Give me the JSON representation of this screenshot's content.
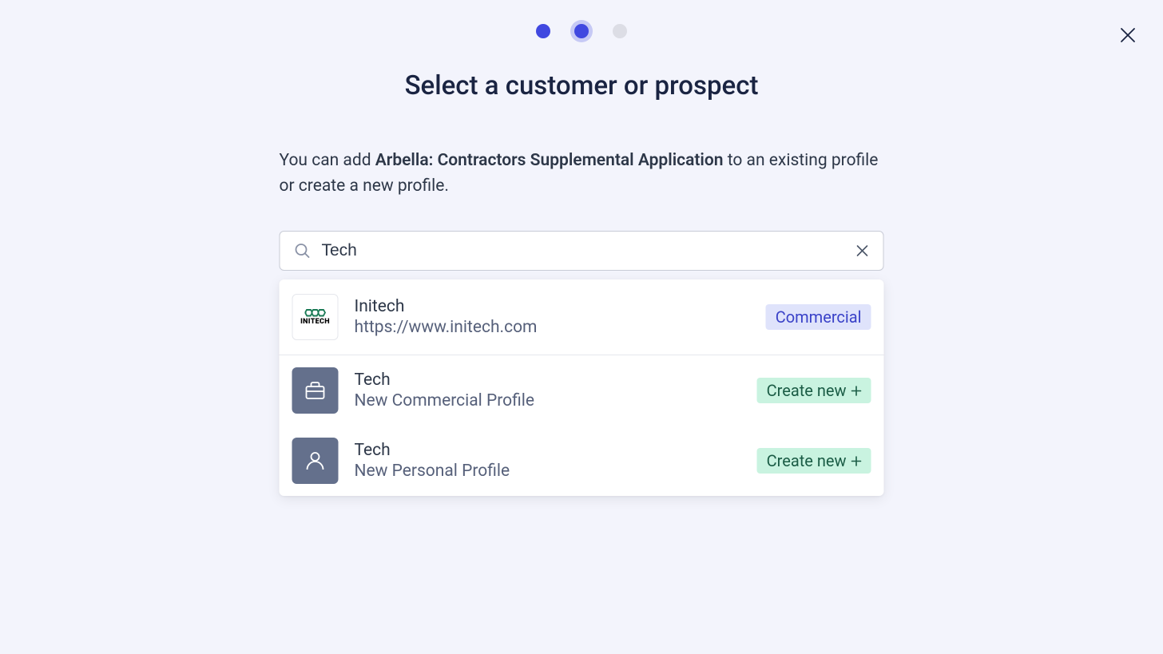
{
  "header": {
    "title": "Select a customer or prospect"
  },
  "instruction": {
    "prefix": "You can add ",
    "bold": "Arbella: Contractors Supplemental Application",
    "suffix": " to an existing profile or create a new profile."
  },
  "search": {
    "value": "Tech"
  },
  "results": {
    "existing": {
      "name": "Initech",
      "url": "https://www.initech.com",
      "logo_text": "INITECH",
      "badge": "Commercial"
    },
    "create_commercial": {
      "name": "Tech",
      "subtitle": "New Commercial Profile",
      "badge": "Create new"
    },
    "create_personal": {
      "name": "Tech",
      "subtitle": "New Personal Profile",
      "badge": "Create new"
    }
  }
}
